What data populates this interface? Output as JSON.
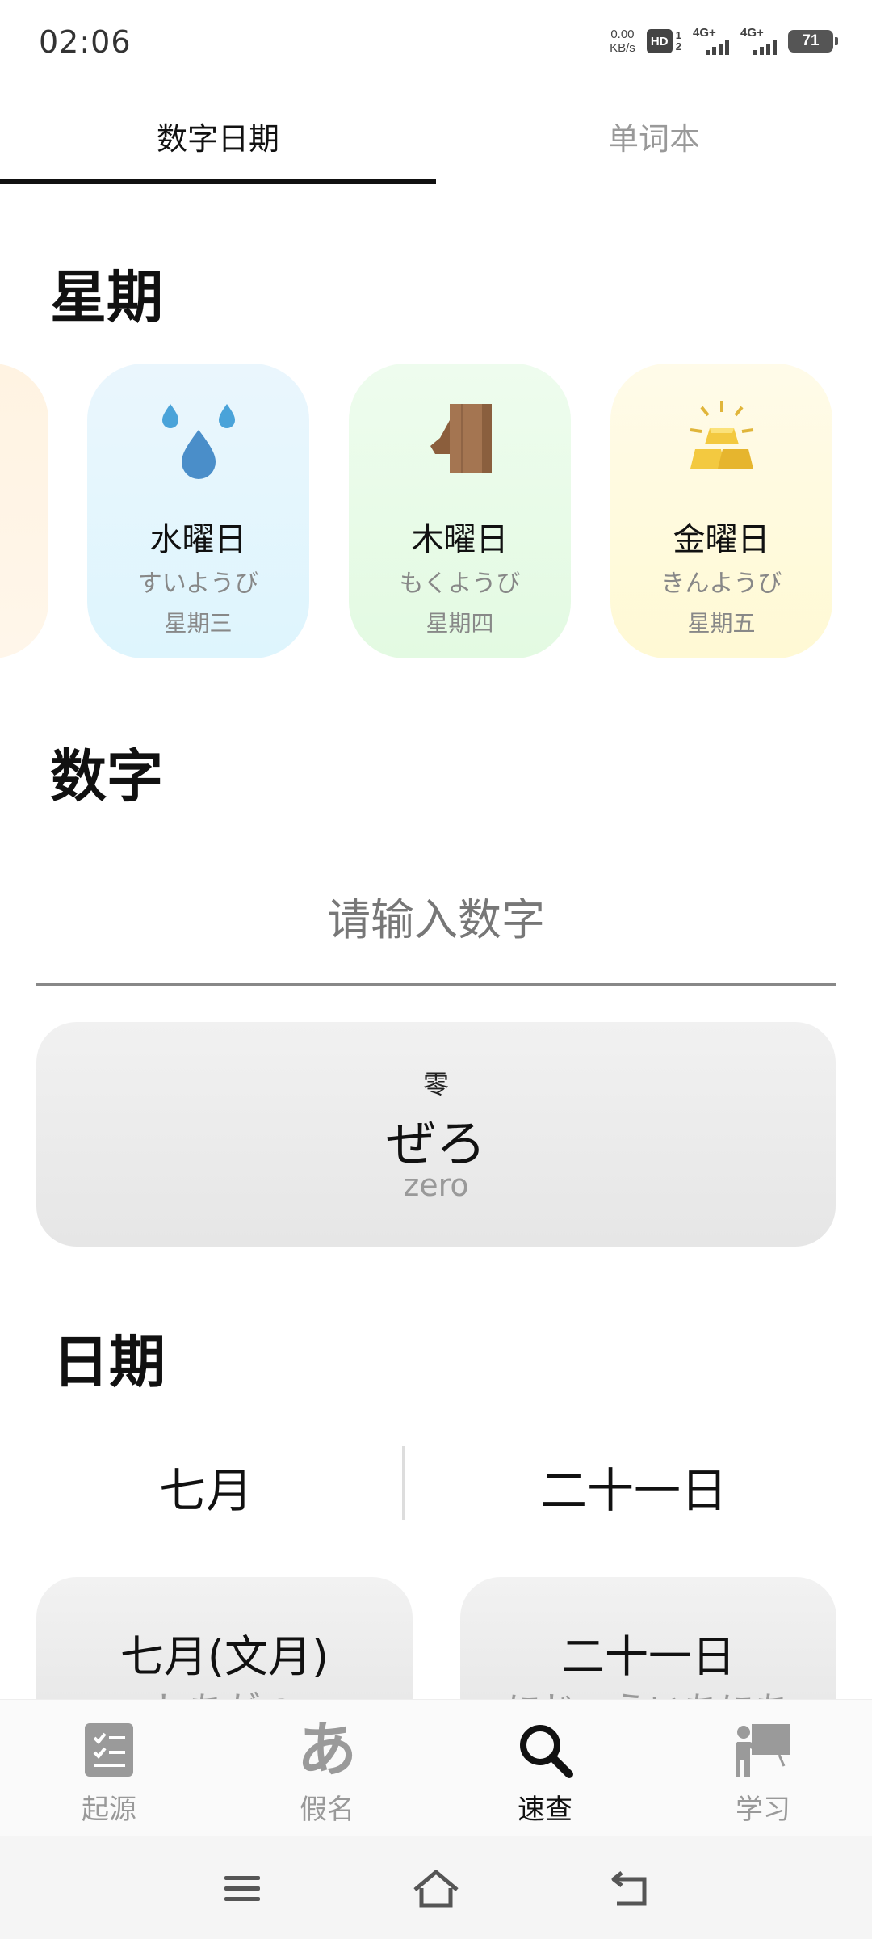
{
  "status_bar": {
    "time": "02:06",
    "net_speed_value": "0.00",
    "net_speed_unit": "KB/s",
    "hd_label": "HD",
    "hd_sub_1": "1",
    "hd_sub_2": "2",
    "signal_1_label": "4G+",
    "signal_2_label": "4G+",
    "battery_level": "71"
  },
  "top_tabs": {
    "numbers_dates": "数字日期",
    "vocabulary": "单词本"
  },
  "weekdays": {
    "title": "星期",
    "items": [
      {
        "name": "水曜日",
        "kana": "すいようび",
        "chinese": "星期三",
        "icon": "water-drops-icon",
        "color": "#e3f5fd"
      },
      {
        "name": "木曜日",
        "kana": "もくようび",
        "chinese": "星期四",
        "icon": "wood-icon",
        "color": "#e8fbe6"
      },
      {
        "name": "金曜日",
        "kana": "きんようび",
        "chinese": "星期五",
        "icon": "gold-bars-icon",
        "color": "#fffbd8"
      }
    ]
  },
  "numbers": {
    "title": "数字",
    "input_placeholder": "请输入数字",
    "result_kanji": "零",
    "result_kana": "ぜろ",
    "result_romaji": "zero"
  },
  "dates": {
    "title": "日期",
    "month_picker": "七月",
    "day_picker": "二十一日",
    "month_card_title": "七月(文月)",
    "month_card_sub": "しちがつ",
    "day_card_title": "二十一日",
    "day_card_sub": "にじゅういちにち"
  },
  "bottom_nav": {
    "origin": "起源",
    "kana": "假名",
    "kana_icon_glyph": "あ",
    "lookup": "速查",
    "study": "学习"
  }
}
